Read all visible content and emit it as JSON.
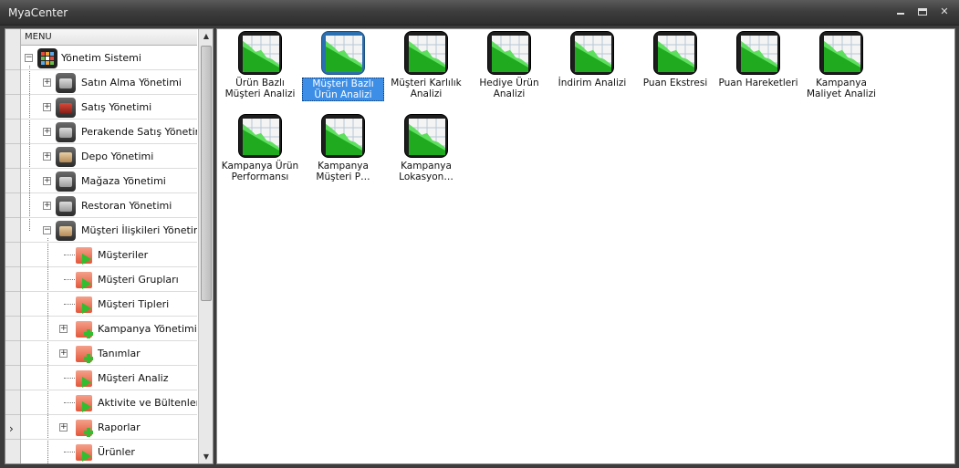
{
  "window": {
    "title": "MyaCenter",
    "controls": {
      "minimize": "minimize-icon",
      "maximize": "maximize-icon",
      "close": "close-icon",
      "close_glyph": "✕"
    }
  },
  "tree": {
    "header": "MENU",
    "items": [
      {
        "label": "Yönetim Sistemi",
        "level": 0,
        "expanded": true,
        "icon": "grid-icon"
      },
      {
        "label": "Satın Alma Yönetimi",
        "level": 1,
        "expanded": false,
        "icon": "purchase-icon"
      },
      {
        "label": "Satış Yönetimi",
        "level": 1,
        "expanded": false,
        "icon": "truck-icon"
      },
      {
        "label": "Perakende Satış Yönetimi",
        "level": 1,
        "expanded": false,
        "icon": "barcode-icon"
      },
      {
        "label": "Depo Yönetimi",
        "level": 1,
        "expanded": false,
        "icon": "warehouse-icon"
      },
      {
        "label": "Mağaza Yönetimi",
        "level": 1,
        "expanded": false,
        "icon": "store-icon"
      },
      {
        "label": "Restoran Yönetimi",
        "level": 1,
        "expanded": false,
        "icon": "restaurant-icon"
      },
      {
        "label": "Müşteri İlişkileri Yönetimi",
        "level": 1,
        "expanded": true,
        "icon": "crm-icon"
      },
      {
        "label": "Müşteriler",
        "level": 2,
        "icon": "report-play-icon"
      },
      {
        "label": "Müşteri Grupları",
        "level": 2,
        "icon": "report-play-icon"
      },
      {
        "label": "Müşteri Tipleri",
        "level": 2,
        "icon": "report-play-icon"
      },
      {
        "label": "Kampanya Yönetimi",
        "level": 2,
        "expanded": false,
        "icon": "report-plus-icon"
      },
      {
        "label": "Tanımlar",
        "level": 2,
        "expanded": false,
        "icon": "report-plus-icon"
      },
      {
        "label": "Müşteri Analiz",
        "level": 2,
        "icon": "report-play-icon"
      },
      {
        "label": "Aktivite ve Bültenler",
        "level": 2,
        "icon": "report-play-icon"
      },
      {
        "label": "Raporlar",
        "level": 2,
        "expanded": false,
        "icon": "report-plus-icon"
      },
      {
        "label": "Ürünler",
        "level": 2,
        "icon": "report-play-icon"
      }
    ],
    "expander_collapsed": "+",
    "expander_expanded": "−",
    "row_pointer": "›"
  },
  "scrollbar": {
    "up": "▲",
    "down": "▼"
  },
  "tiles": [
    {
      "label": "Ürün Bazlı Müşteri Analizi",
      "selected": false
    },
    {
      "label": "Müşteri Bazlı Ürün Analizi",
      "selected": true
    },
    {
      "label": "Müşteri Karlılık Analizi",
      "selected": false
    },
    {
      "label": "Hediye Ürün Analizi",
      "selected": false
    },
    {
      "label": "İndirim Analizi",
      "selected": false
    },
    {
      "label": "Puan Ekstresi",
      "selected": false
    },
    {
      "label": "Puan Hareketleri",
      "selected": false
    },
    {
      "label": "Kampanya Maliyet Analizi",
      "selected": false
    },
    {
      "label": "Kampanya Ürün Performansı",
      "selected": false
    },
    {
      "label": "Kampanya Müşteri P…",
      "selected": false
    },
    {
      "label": "Kampanya Lokasyon…",
      "selected": false
    }
  ],
  "tile_icon": "area-chart-icon",
  "colors": {
    "chart_green": "#22b522",
    "selected_bg": "#3d8ee6",
    "titlebar": "#3e3e3e"
  }
}
